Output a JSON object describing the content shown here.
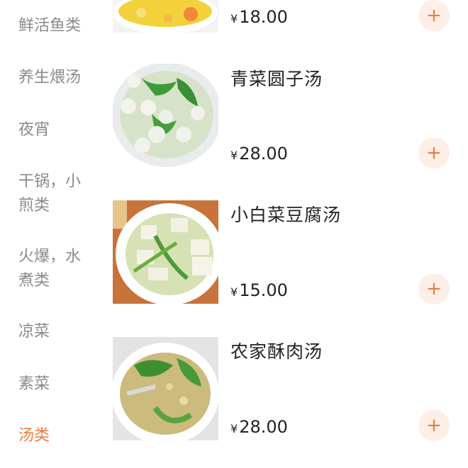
{
  "sidebar": {
    "items": [
      {
        "label": "鲜活鱼类",
        "active": false
      },
      {
        "label": "养生煨汤",
        "active": false
      },
      {
        "label": "夜宵",
        "active": false
      },
      {
        "label": "干锅，小",
        "label2": "煎类",
        "active": false
      },
      {
        "label": "火爆，水",
        "label2": "煮类",
        "active": false
      },
      {
        "label": "凉菜",
        "active": false
      },
      {
        "label": "素菜",
        "active": false
      },
      {
        "label": "汤类",
        "active": true
      }
    ]
  },
  "dishes": [
    {
      "name": "",
      "price": "18.00",
      "currency": "¥"
    },
    {
      "name": "青菜圆子汤",
      "price": "28.00",
      "currency": "¥"
    },
    {
      "name": "小白菜豆腐汤",
      "price": "15.00",
      "currency": "¥"
    },
    {
      "name": "农家酥肉汤",
      "price": "28.00",
      "currency": "¥"
    }
  ],
  "add_label": "+",
  "colors": {
    "accent": "#f07a3c",
    "add_bg": "#fdeee6",
    "inactive_text": "#8a8a8a"
  }
}
